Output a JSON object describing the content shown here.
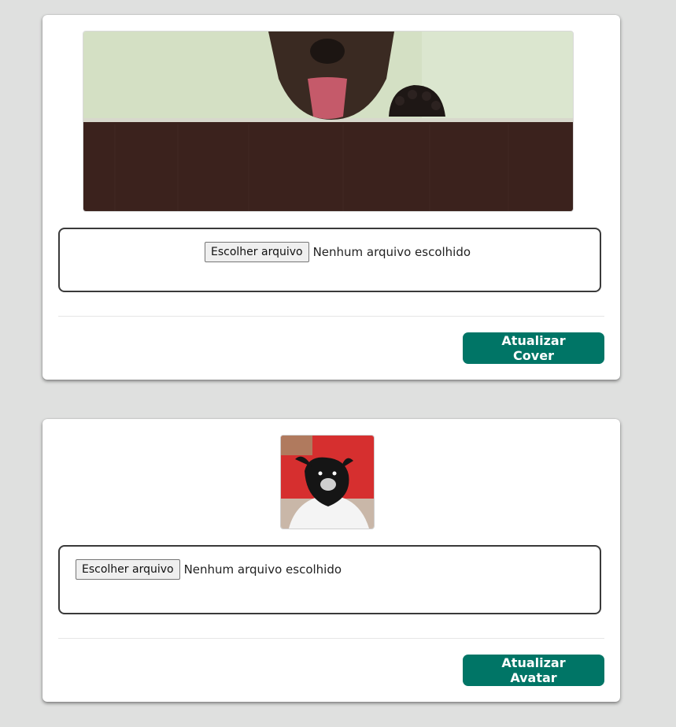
{
  "cover_card": {
    "image_alt": "cover-photo",
    "choose_file_label": "Escolher arquivo",
    "no_file_text": "Nenhum arquivo escolhido",
    "submit_label": "Atualizar Cover"
  },
  "avatar_card": {
    "image_alt": "avatar-photo",
    "choose_file_label": "Escolher arquivo",
    "no_file_text": "Nenhum arquivo escolhido",
    "submit_label": "Atualizar Avatar"
  },
  "colors": {
    "page_bg": "#dfe0df",
    "primary_button": "#007566"
  }
}
